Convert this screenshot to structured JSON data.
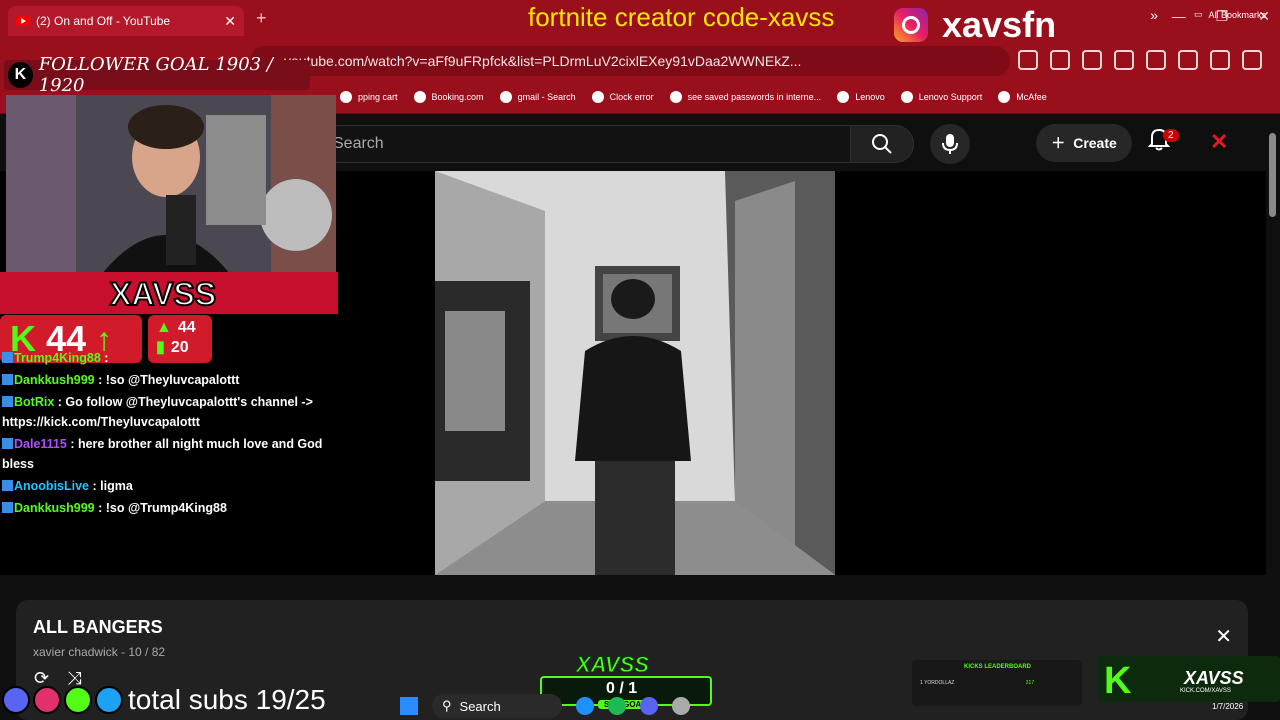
{
  "browser": {
    "tab_title": "(2) On and Off - YouTube",
    "url": "youtube.com/watch?v=aFf9uFRpfck&list=PLDrmLuV2cixlEXey91vDaa2WWNEkZ...",
    "bookmarks": [
      "pping cart",
      "Booking.com",
      "gmail - Search",
      "Clock error",
      "see saved passwords in interne...",
      "Lenovo",
      "Lenovo Support",
      "McAfee"
    ],
    "all_bookmarks": "All Bookmarks",
    "new_tab": "+",
    "extension_badge": "99+"
  },
  "youtube": {
    "search_placeholder": "Search",
    "create_label": "Create",
    "notifications": "2"
  },
  "playlist": {
    "title": "ALL BANGERS",
    "subtitle": "xavier chadwick - 10 / 82"
  },
  "overlay": {
    "promo": "fortnite creator code-xavss",
    "handle": "xavsfn",
    "follower_goal": "FOLLOWER GOAL 1903 / 1920",
    "name": "XAVSS",
    "kick_viewers": "44",
    "stat_top": "44",
    "stat_bottom": "20",
    "subs_text": "total subs 19/25",
    "sub_goal_logo": "XAVSS",
    "sub_goal_value": "0 / 1",
    "sub_goal_label": "SUB GOAL",
    "leaderboard_title": "KICKS LEADERBOARD",
    "leaderboard_user": "1 YORDOLLAZ",
    "leaderboard_value": "317",
    "brand_name": "XAVSS",
    "brand_url": "KICK.COM/XAVSS",
    "chat": [
      {
        "user": "Trump4King88",
        "text": " : ",
        "color": "green"
      },
      {
        "user": "Dankkush999",
        "text": " : !so @Theyluvcapalottt",
        "color": "green"
      },
      {
        "user": "BotRix",
        "text": " : Go follow @Theyluvcapalottt's channel -> https://kick.com/Theyluvcapalottt",
        "color": "green"
      },
      {
        "user": "Dale1115",
        "text": " : here brother all night much love and God bless",
        "color": "purple"
      },
      {
        "user": "AnoobisLive",
        "text": " : ligma",
        "color": "cyan"
      },
      {
        "user": "Dankkush999",
        "text": " : !so @Trump4King88",
        "color": "green"
      }
    ]
  },
  "taskbar": {
    "search": "Search",
    "date": "1/7/2026"
  },
  "colors": {
    "browser_red": "#9a0f1c",
    "kick_green": "#53fc18",
    "promo_yellow": "#ffe600"
  }
}
